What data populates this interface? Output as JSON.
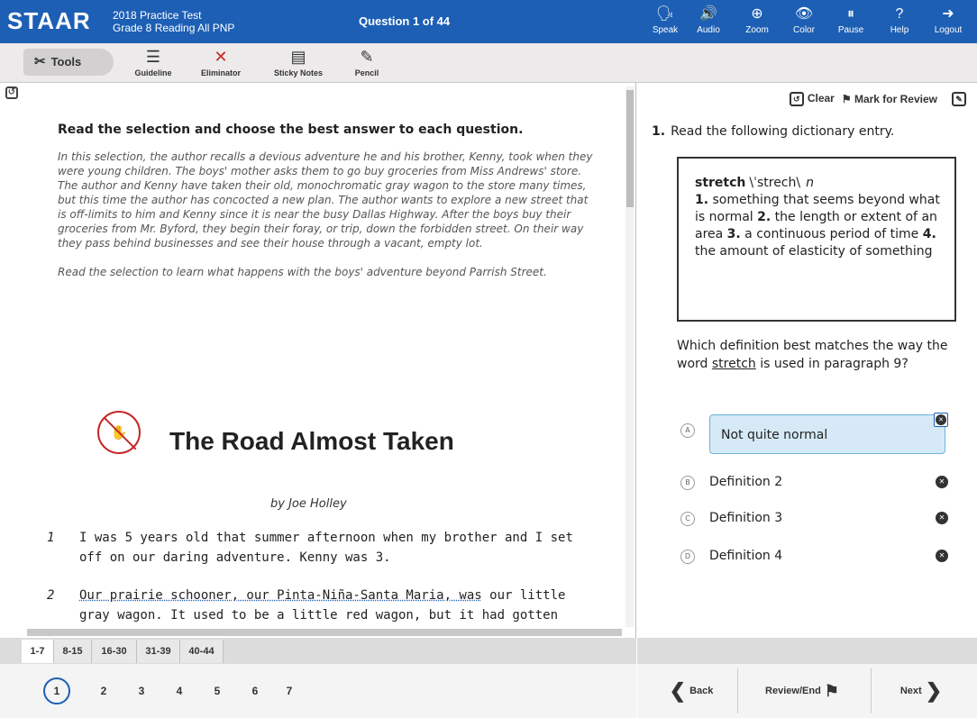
{
  "header": {
    "logo": "STAAR",
    "test_name": "2018 Practice Test",
    "test_subtitle": "Grade 8 Reading All PNP",
    "question_counter": "Question 1 of 44",
    "buttons": [
      {
        "label": "Speak",
        "icon": "speak-icon",
        "glyph": "🗣"
      },
      {
        "label": "Audio",
        "icon": "audio-icon",
        "glyph": "🔊"
      },
      {
        "label": "Zoom",
        "icon": "zoom-icon",
        "glyph": "⊕"
      },
      {
        "label": "Color",
        "icon": "eye-icon",
        "glyph": "👁"
      },
      {
        "label": "Pause",
        "icon": "pause-icon",
        "glyph": "⏸"
      },
      {
        "label": "Help",
        "icon": "help-icon",
        "glyph": "?"
      },
      {
        "label": "Logout",
        "icon": "logout-icon",
        "glyph": "➜"
      }
    ]
  },
  "tools": {
    "label": "Tools",
    "items": [
      {
        "label": "Guideline",
        "icon": "guideline-icon",
        "glyph": "☰"
      },
      {
        "label": "Eliminator",
        "icon": "eliminator-icon",
        "glyph": "✕"
      },
      {
        "label": "Sticky Notes",
        "icon": "sticky-notes-icon",
        "glyph": "▤"
      },
      {
        "label": "Pencil",
        "icon": "pencil-icon",
        "glyph": "✎"
      }
    ]
  },
  "passage": {
    "instruction": "Read the selection and choose the best answer to each question.",
    "intro": "In this selection, the author recalls a devious adventure he and his brother, Kenny, took when they were young children. The boys' mother asks them to go buy groceries from Miss Andrews' store. The author and Kenny have taken their old, monochromatic gray wagon to the store many times, but this time the author has concocted a new plan. The author wants to explore a new street that is off-limits to him and Kenny since it is near the busy Dallas Highway. After the boys buy their groceries from Mr. Byford, they begin their foray, or trip, down the forbidden street. On their way they pass behind businesses and see their house through a vacant, empty lot.",
    "note": "Read the selection to learn what happens with the boys' adventure beyond Parrish Street.",
    "title": "The Road Almost Taken",
    "byline": "by Joe Holley",
    "paragraphs": [
      {
        "num": "1",
        "text": "I was 5 years old that summer afternoon when my brother and I set off on our daring adventure. Kenny was 3."
      },
      {
        "num": "2",
        "underlined": "Our prairie schooner, our Pinta-Niña-Santa Maria, was",
        "text": " our little gray wagon. It used to be a little red wagon, but it had gotten"
      }
    ]
  },
  "question": {
    "clear_label": "Clear",
    "mark_label": "Mark for Review",
    "number": "1.",
    "stem": "Read the following dictionary entry.",
    "dictionary": {
      "headword": "stretch",
      "pronunciation": "\\ˈstrech\\",
      "pos": "n",
      "d1_num": "1.",
      "d1": " something that seems beyond what is normal ",
      "d2_num": "2.",
      "d2": " the length or extent of an area ",
      "d3_num": "3.",
      "d3": " a continuous period of time ",
      "d4_num": "4.",
      "d4": " the amount of elasticity of something"
    },
    "prompt_before": "Which definition best matches the way the word ",
    "prompt_word": "stretch",
    "prompt_after": " is used in paragraph 9?",
    "choices": [
      {
        "letter": "A",
        "text": "Not quite normal"
      },
      {
        "letter": "B",
        "text": "Definition 2"
      },
      {
        "letter": "C",
        "text": "Definition 3"
      },
      {
        "letter": "D",
        "text": "Definition 4"
      }
    ]
  },
  "footer": {
    "ranges": [
      "1-7",
      "8-15",
      "16-30",
      "31-39",
      "40-44"
    ],
    "question_numbers": [
      "1",
      "2",
      "3",
      "4",
      "5",
      "6",
      "7"
    ],
    "back_label": "Back",
    "review_label": "Review/End",
    "next_label": "Next"
  }
}
